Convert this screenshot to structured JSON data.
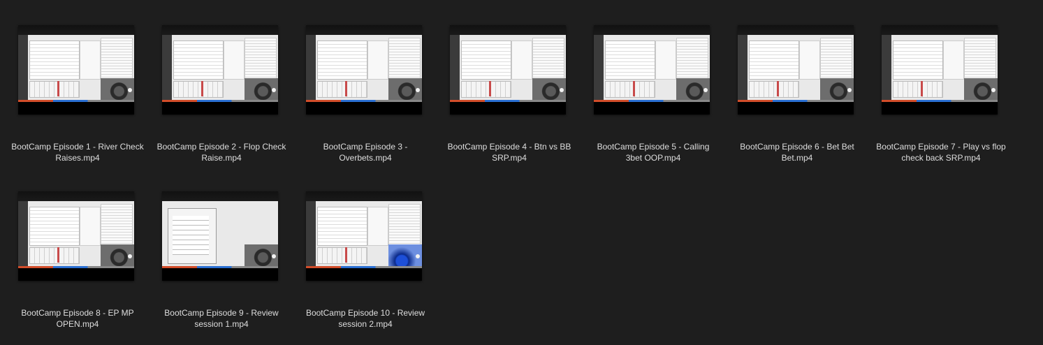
{
  "files": [
    {
      "line1": "BootCamp Episode 1 - River Check",
      "line2": "Raises.mp4",
      "thumb": "solver-icon"
    },
    {
      "line1": "BootCamp Episode 2 - Flop Check",
      "line2": "Raise.mp4",
      "thumb": "solver-icon"
    },
    {
      "line1": "BootCamp Episode 3 -",
      "line2": "Overbets.mp4",
      "thumb": "solver-icon"
    },
    {
      "line1": "BootCamp Episode 4 - Btn vs BB",
      "line2": "SRP.mp4",
      "thumb": "solver-icon"
    },
    {
      "line1": "BootCamp Episode 5 - Calling",
      "line2": "3bet OOP.mp4",
      "thumb": "solver-icon"
    },
    {
      "line1": "BootCamp Episode 6 - Bet Bet",
      "line2": "Bet.mp4",
      "thumb": "solver-icon"
    },
    {
      "line1": "BootCamp Episode 7 - Play vs flop",
      "line2": "check back SRP.mp4",
      "thumb": "solver-icon"
    },
    {
      "line1": "BootCamp Episode 8 - EP MP",
      "line2": "OPEN.mp4",
      "thumb": "solver-icon"
    },
    {
      "line1": "BootCamp Episode 9 - Review",
      "line2": "session 1.mp4",
      "thumb": "desktop-icon"
    },
    {
      "line1": "BootCamp Episode 10 - Review",
      "line2": "session 2.mp4",
      "thumb": "solver-icon"
    }
  ],
  "colors": {
    "background": "#1e1e1e",
    "label_text": "#dedede"
  }
}
